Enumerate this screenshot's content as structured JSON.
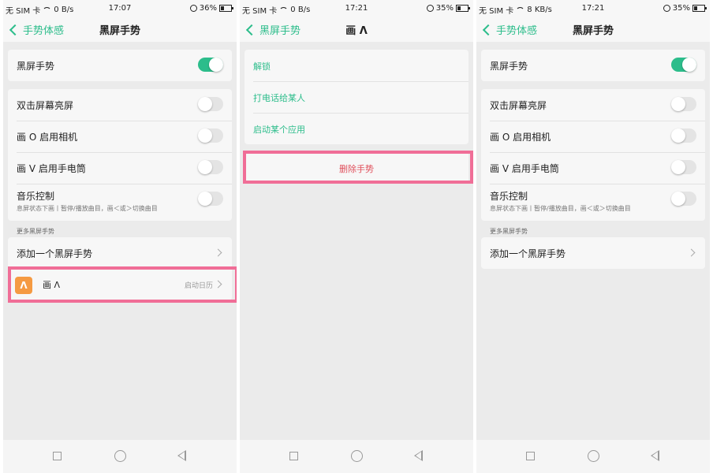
{
  "colors": {
    "accent": "#2cbd8b",
    "highlight": "#f06e97",
    "delete": "#e0505c",
    "app_icon_bg": "#f59a42"
  },
  "screens": [
    {
      "status": {
        "carrier": "无 SIM 卡",
        "speed": "0 B/s",
        "time": "17:07",
        "battery": "36%",
        "battery_level": 0.36
      },
      "nav": {
        "back_label": "手势体感",
        "title": "黑屏手势"
      },
      "master": {
        "label": "黑屏手势",
        "on": true
      },
      "toggles": [
        {
          "label": "双击屏幕亮屏",
          "on": false
        },
        {
          "label": "画 O 启用相机",
          "on": false
        },
        {
          "label": "画 V 启用手电筒",
          "on": false
        },
        {
          "label": "音乐控制",
          "sublabel": "息屏状态下画丨暂停/播放曲目，画＜或＞切换曲目",
          "on": false
        }
      ],
      "section_header": "更多黑屏手势",
      "add_label": "添加一个黑屏手势",
      "custom_gesture": {
        "icon": "Λ",
        "label": "画 Λ",
        "action": "启动日历"
      }
    },
    {
      "status": {
        "carrier": "无 SIM 卡",
        "speed": "0 B/s",
        "time": "17:21",
        "battery": "35%",
        "battery_level": 0.35
      },
      "nav": {
        "back_label": "黑屏手势",
        "title": "画 Λ"
      },
      "options": [
        "解锁",
        "打电话给某人",
        "启动某个应用"
      ],
      "delete_label": "删除手势"
    },
    {
      "status": {
        "carrier": "无 SIM 卡",
        "speed": "8 KB/s",
        "time": "17:21",
        "battery": "35%",
        "battery_level": 0.35
      },
      "nav": {
        "back_label": "手势体感",
        "title": "黑屏手势"
      },
      "master": {
        "label": "黑屏手势",
        "on": true
      },
      "toggles": [
        {
          "label": "双击屏幕亮屏",
          "on": false
        },
        {
          "label": "画 O 启用相机",
          "on": false
        },
        {
          "label": "画 V 启用手电筒",
          "on": false
        },
        {
          "label": "音乐控制",
          "sublabel": "息屏状态下画丨暂停/播放曲目，画＜或＞切换曲目",
          "on": false
        }
      ],
      "section_header": "更多黑屏手势",
      "add_label": "添加一个黑屏手势"
    }
  ]
}
